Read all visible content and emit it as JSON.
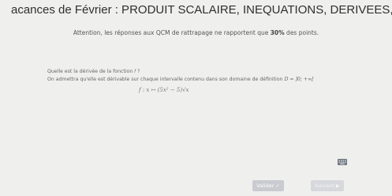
{
  "header": {
    "title": "acances de Février : PRODUIT SCALAIRE, INEQUATIONS, DERIVEES, P"
  },
  "notice": {
    "before": "Attention, les réponses aux QCM de rattrapage ne rapportent que ",
    "highlight": "30%",
    "after": " des points."
  },
  "question": {
    "line1": "Quelle est la dérivée de la fonction 𝑓 ?",
    "line2": "On admettra qu'elle est dérivable sur chaque intervalle contenu dans son domaine de définition",
    "domain": "D = ]0; +∞[",
    "formula": "f : x ↦ (5x² − 5)√x"
  },
  "buttons": {
    "validate_label": "Valider ✓",
    "next_label": "Suivant ▶"
  },
  "icons": {
    "keyboard": "keyboard-icon"
  }
}
